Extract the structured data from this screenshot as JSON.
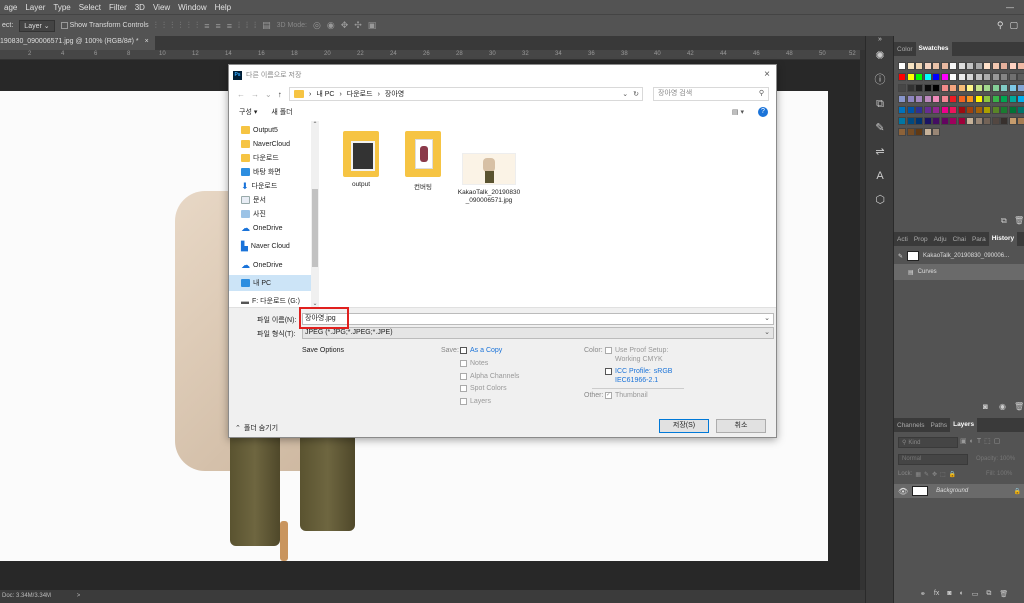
{
  "menu": {
    "items": [
      "age",
      "Layer",
      "Type",
      "Select",
      "Filter",
      "3D",
      "View",
      "Window",
      "Help"
    ]
  },
  "options": {
    "select_label": "ect:",
    "select_value": "Layer",
    "transform_label": "Show Transform Controls",
    "mode_label": "3D Mode:"
  },
  "document": {
    "tab_title": "190830_090006571.jpg @ 100% (RGB/8#) *",
    "tab_close": "×",
    "status": "Doc: 3.34M/3.34M",
    "status_arrow": ">"
  },
  "ruler": {
    "ticks": [
      "2",
      "4",
      "6",
      "8",
      "10",
      "12",
      "14",
      "16",
      "18",
      "20",
      "22",
      "24",
      "26",
      "28",
      "30",
      "32",
      "34",
      "36",
      "38",
      "40",
      "42",
      "44",
      "46",
      "48",
      "50",
      "52"
    ]
  },
  "panels": {
    "color_tabs": [
      "Color",
      "Swatches"
    ],
    "history_tabs": [
      "Acti",
      "Prop",
      "Adju",
      "Chai",
      "Para",
      "History"
    ],
    "history_items": [
      "KakaoTalk_20190830_090006...",
      "Curves"
    ],
    "layers_tabs": [
      "Channels",
      "Paths",
      "Layers"
    ],
    "layers_kind": "Kind",
    "layers_blend": "Normal",
    "layers_opacity": "Opacity:",
    "layers_opacity_value": "100%",
    "layers_lock": "Lock:",
    "layers_fill": "Fill:",
    "layers_fill_value": "100%",
    "background_layer": "Background"
  },
  "swatches": {
    "rows": [
      [
        "#ffffff",
        "#f7e3c2",
        "#f0d5b3",
        "#f4d3c0",
        "#e9c2a8",
        "#e8b8a0",
        "#f7f7f7",
        "#dddddd",
        "#c3c3c3",
        "#aaaaaa",
        "#ffe0c9",
        "#f2c7b0",
        "#e6b19c",
        "#ffd2c2",
        "#f0b9a4"
      ],
      [
        "#ff0000",
        "#ffff00",
        "#00ff00",
        "#00ffff",
        "#0000ff",
        "#ff00ff",
        "#ffffff",
        "#ebebeb",
        "#d6d6d6",
        "#c2c2c2",
        "#adadad",
        "#999999",
        "#858585",
        "#707070",
        "#5c5c5c"
      ],
      [
        "#474747",
        "#333333",
        "#1f1f1f",
        "#0a0a0a",
        "#000000",
        "#f28a8a",
        "#f5a57f",
        "#f7bd77",
        "#fff58a",
        "#c5e38a",
        "#a3d88f",
        "#84cf97",
        "#81ccc6",
        "#7cc8e7",
        "#82a5d5"
      ],
      [
        "#8896cb",
        "#8e86c0",
        "#a487bf",
        "#bd89be",
        "#f08bbb",
        "#f38796",
        "#ed1c24",
        "#f26522",
        "#f7941d",
        "#fff200",
        "#8dc63f",
        "#39b54a",
        "#00a651",
        "#00a99d",
        "#00aeef"
      ],
      [
        "#0072bc",
        "#0054a6",
        "#2e3192",
        "#662d91",
        "#92278f",
        "#ec008c",
        "#ed145b",
        "#9e0b0f",
        "#a0410d",
        "#a36209",
        "#aba000",
        "#598527",
        "#1a7b30",
        "#007236",
        "#00746b"
      ],
      [
        "#0076a3",
        "#004a80",
        "#003471",
        "#1b1464",
        "#440e62",
        "#630460",
        "#9e005d",
        "#9e0039",
        "#c7b299",
        "#998675",
        "#736357",
        "#534741",
        "#37302d",
        "#c69c6d",
        "#a67c52"
      ],
      [
        "#8c6239",
        "#754c24",
        "#603913",
        "#c7b299",
        "#998675"
      ]
    ]
  },
  "dialog": {
    "title": "다른 이름으로 저장",
    "close": "×",
    "address": [
      "내 PC",
      "다운로드",
      "장아영"
    ],
    "search_placeholder": "장아영 검색",
    "organize": "구성",
    "new_folder": "새 폴더",
    "nav_items": [
      {
        "label": "Output5",
        "pin": "✱"
      },
      {
        "label": "NaverCloud",
        "pin": "✱"
      },
      {
        "label": "다운로드",
        "pin": "✱"
      },
      {
        "label": "바탕 화면",
        "pin": "✱"
      },
      {
        "label": "다운로드",
        "pin": "✱"
      },
      {
        "label": "문서",
        "pin": "✱"
      },
      {
        "label": "사진",
        "pin": "✱"
      },
      {
        "label": "OneDrive",
        "pin": "✱"
      },
      {
        "label": "Naver Cloud",
        "pin": ""
      },
      {
        "label": "OneDrive",
        "pin": ""
      },
      {
        "label": "내 PC",
        "pin": ""
      },
      {
        "label": "F: 다운로드 (G:)",
        "pin": ""
      }
    ],
    "files": [
      {
        "name": "output"
      },
      {
        "name": "컨버팅"
      },
      {
        "name": "KakaoTalk_20190830_090006571.jpg"
      }
    ],
    "filename_label": "파일 이름(N):",
    "filename_value": "장아영.jpg",
    "filetype_label": "파일 형식(T):",
    "filetype_value": "JPEG (*.JPG;*.JPEG;*.JPE)",
    "save_options": "Save Options",
    "save_label": "Save:",
    "as_copy": "As a Copy",
    "notes": "Notes",
    "alpha": "Alpha Channels",
    "spot": "Spot Colors",
    "layers": "Layers",
    "color_label": "Color:",
    "proof_setup": "Use Proof Setup:",
    "proof_value": "Working CMYK",
    "icc_label": "ICC Profile:",
    "icc_value": "sRGB",
    "icc_value2": "IEC61966-2.1",
    "other_label": "Other:",
    "thumbnail": "Thumbnail",
    "hide_folders": "폴더 숨기기",
    "save_btn": "저장(S)",
    "cancel_btn": "취소"
  }
}
